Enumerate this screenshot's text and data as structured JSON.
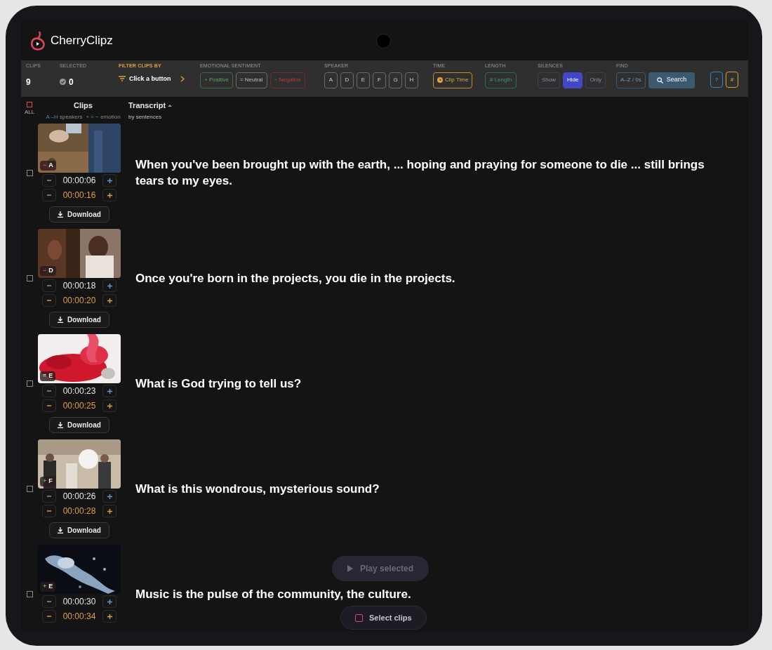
{
  "app": {
    "logo": "CherryClipz"
  },
  "stats": [
    {
      "label": "CLIPS",
      "value": "9"
    },
    {
      "label": "SELECTED",
      "value": "0"
    }
  ],
  "filter": {
    "label": "FILTER CLIPS BY",
    "button": "Click a button"
  },
  "sentiment": {
    "label": "EMOTIONAL SENTIMENT",
    "buttons": [
      {
        "label": "+ Positive",
        "kind": "positive"
      },
      {
        "label": "= Neutral",
        "kind": "neutral"
      },
      {
        "label": "− Negative",
        "kind": "negative"
      }
    ]
  },
  "speaker": {
    "label": "SPEAKER",
    "buttons": [
      "A",
      "D",
      "E",
      "F",
      "G",
      "H"
    ]
  },
  "time": {
    "label": "TIME",
    "button": "Clip Time"
  },
  "length": {
    "label": "LENGTH",
    "button": "# Length"
  },
  "silences": {
    "label": "SILENCES",
    "options": [
      {
        "label": "Show",
        "selected": false
      },
      {
        "label": "Hide",
        "selected": true
      },
      {
        "label": "Only",
        "selected": false
      }
    ]
  },
  "find": {
    "label": "FIND",
    "sort_button": "A–Z / 0s",
    "search_button": "Search"
  },
  "extra_buttons": [
    {
      "label": "?",
      "color": "#3b82c4"
    },
    {
      "label": "#",
      "color": "#d4a02a"
    }
  ],
  "table": {
    "select_all": "ALL",
    "all_checked": false,
    "clips_heading": "Clips",
    "clips_legend": [
      {
        "text": "A –H",
        "kind": "speaker"
      },
      {
        "text": " speakers",
        "kind": "caption"
      },
      {
        "text": "+ = −",
        "kind": "emotion"
      },
      {
        "text": " emotion",
        "kind": "caption"
      }
    ],
    "transcript_heading": "Transcript",
    "transcript_sub": "by sentences"
  },
  "clips": [
    {
      "emotion": "−",
      "kind": "negative",
      "speaker": "A",
      "checked": false,
      "start": "00:00:06",
      "end": "00:00:16",
      "download": "Download",
      "text": "When you've been brought up with the earth, ... hoping and praying for someone to die ... still brings tears to my eyes."
    },
    {
      "emotion": "−",
      "kind": "negative",
      "speaker": "D",
      "checked": false,
      "start": "00:00:18",
      "end": "00:00:20",
      "download": "Download",
      "text": "Once you're born in the projects, you die in the projects."
    },
    {
      "emotion": "=",
      "kind": "neutral",
      "speaker": "E",
      "checked": false,
      "start": "00:00:23",
      "end": "00:00:25",
      "download": "Download",
      "text": "What is God trying to tell us?"
    },
    {
      "emotion": "+",
      "kind": "positive",
      "speaker": "F",
      "checked": false,
      "start": "00:00:26",
      "end": "00:00:28",
      "download": "Download",
      "text": "What is this wondrous, mysterious sound?"
    },
    {
      "emotion": "+",
      "kind": "positive",
      "speaker": "E",
      "checked": false,
      "start": "00:00:30",
      "end": "00:00:34",
      "text": "Music is the pulse of the community, the culture."
    }
  ],
  "floating": {
    "play_button": "Play selected",
    "select_button": "Select clips"
  }
}
